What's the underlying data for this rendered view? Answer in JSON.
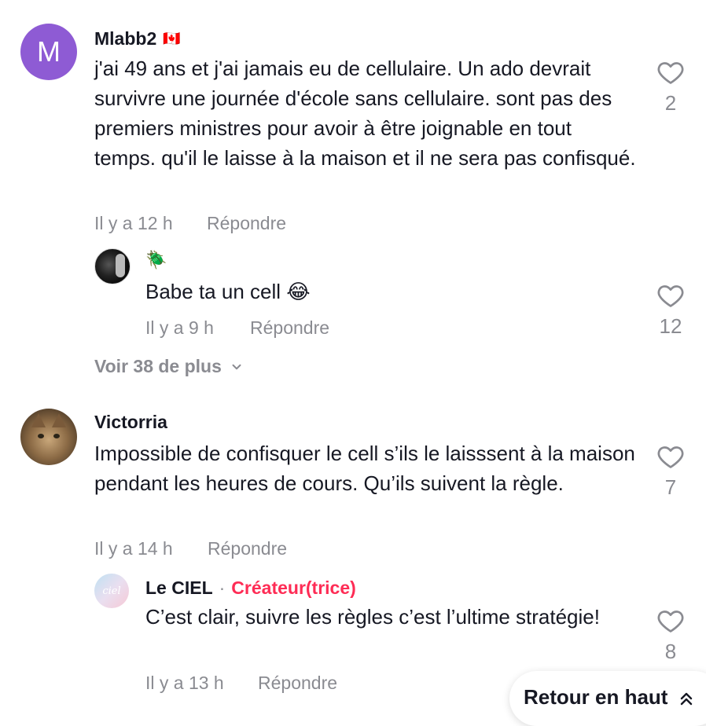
{
  "comments": [
    {
      "avatar_letter": "M",
      "username": "Mlabb2",
      "flag": "🇨🇦",
      "text": "j'ai 49 ans et j'ai jamais eu de cellulaire. Un ado devrait survivre une journée d'école sans cellulaire. sont pas des premiers ministres pour avoir à être joignable en tout temps. qu'il le laisse à la maison et il ne sera pas confisqué.",
      "time": "Il y a 12 h",
      "reply_label": "Répondre",
      "likes": "2",
      "replies": [
        {
          "username_emoji": "🪲",
          "text": "Babe ta un cell 😂",
          "time": "Il y a 9 h",
          "reply_label": "Répondre",
          "likes": "12"
        }
      ],
      "more_label": "Voir 38 de plus"
    },
    {
      "username": "Victorria",
      "text": "Impossible de confisquer le cell s’ils le laisssent à la maison pendant les heures de cours. Qu’ils suivent la règle.",
      "time": "Il y a 14 h",
      "reply_label": "Répondre",
      "likes": "7",
      "replies": [
        {
          "avatar_text": "ciel",
          "username": "Le CIEL",
          "separator": "·",
          "creator_badge": "Créateur(trice)",
          "text": "C’est clair, suivre les règles c’est l’ultime stratégie!",
          "time": "Il y a 13 h",
          "reply_label": "Répondre",
          "likes": "8"
        }
      ]
    }
  ],
  "back_to_top": {
    "label": "Retour en haut"
  }
}
